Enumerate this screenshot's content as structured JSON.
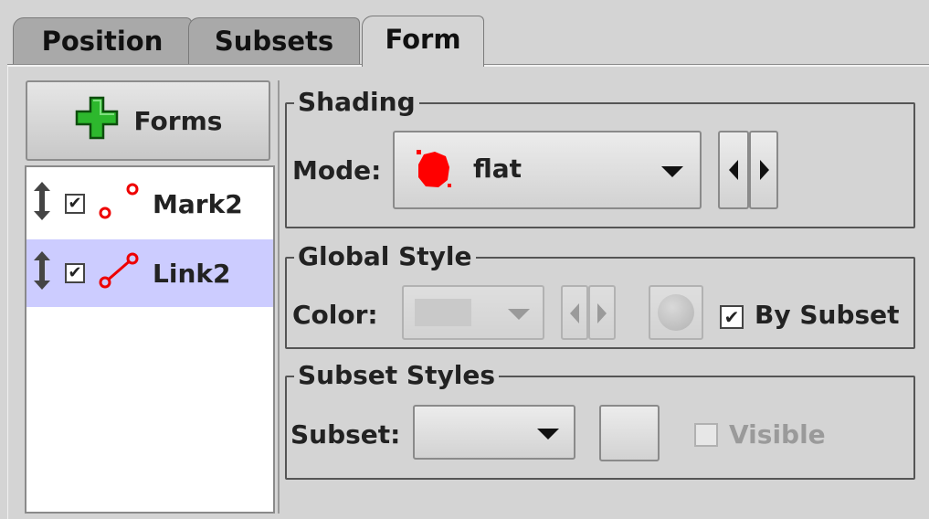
{
  "tabs": [
    {
      "label": "Position"
    },
    {
      "label": "Subsets"
    },
    {
      "label": "Form"
    }
  ],
  "forms_button": {
    "label": "Forms",
    "icon": "plus-icon"
  },
  "layers": [
    {
      "label": "Mark2",
      "checked": true,
      "icon": "mark-icon"
    },
    {
      "label": "Link2",
      "checked": true,
      "icon": "link-icon",
      "selected": true
    }
  ],
  "shading": {
    "title": "Shading",
    "mode_label": "Mode:",
    "mode_value": "flat"
  },
  "global_style": {
    "title": "Global Style",
    "color_label": "Color:",
    "by_subset_label": "By Subset",
    "by_subset_checked": true
  },
  "subset_styles": {
    "title": "Subset Styles",
    "subset_label": "Subset:",
    "visible_label": "Visible",
    "visible_checked": false
  },
  "colors": {
    "accent_red": "#ff0000",
    "selection": "#ccccff",
    "plus_green": "#22b322"
  }
}
